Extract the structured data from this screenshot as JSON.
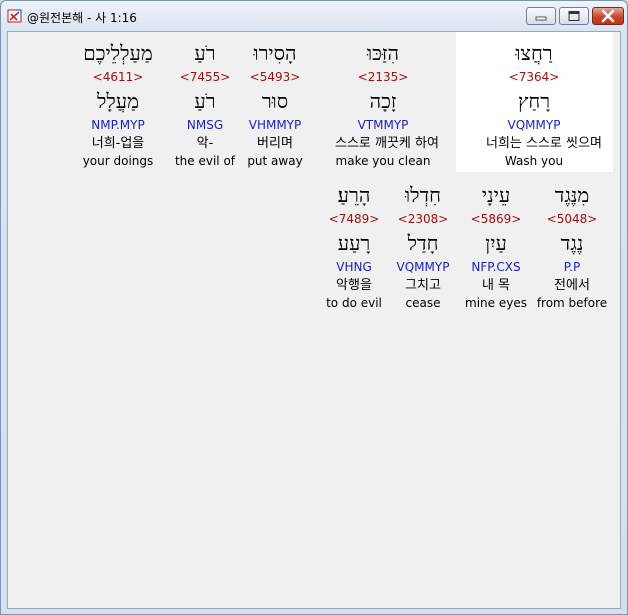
{
  "window": {
    "title": "@원전본해 - 사 1:16"
  },
  "colors": {
    "strong": "#a01010",
    "morph": "#1a22c0",
    "highlight": "#ffffff"
  },
  "rows": [
    {
      "words": [
        {
          "hebrew": "רַחֲצוּ",
          "strong": "<7364>",
          "lemma": "רָחַץ",
          "morph": "VQMMYP",
          "korean": "너희는 스스로 씻으며",
          "english": "Wash you",
          "highlighted": true
        },
        {
          "hebrew": "הִזַּכּוּ",
          "strong": "<2135>",
          "lemma": "זָכָה",
          "morph": "VTMMYP",
          "korean": "스스로 깨끗케 하여",
          "english": "make you clean"
        },
        {
          "hebrew": "הָסִירוּ",
          "strong": "<5493>",
          "lemma": "סוּר",
          "morph": "VHMMYP",
          "korean": "버리며",
          "english": "put away"
        },
        {
          "hebrew": "רֹעַ",
          "strong": "<7455>",
          "lemma": "רֹעַ",
          "morph": "NMSG",
          "korean": "악-",
          "english": "the evil of"
        },
        {
          "hebrew": "מַעַלְלֵיכֶם",
          "strong": "<4611>",
          "lemma": "מַעֲלָל",
          "morph": "NMP.MYP",
          "korean": "너희-업을",
          "english": "your doings"
        }
      ]
    },
    {
      "words": [
        {
          "hebrew": "מִנֶּגֶד",
          "strong": "<5048>",
          "lemma": "נֶגֶד",
          "morph": "P.P",
          "korean": "전에서",
          "english": "from before"
        },
        {
          "hebrew": "עֵינָי",
          "strong": "<5869>",
          "lemma": "עַיִן",
          "morph": "NFP.CXS",
          "korean": "내 목",
          "english": "mine eyes"
        },
        {
          "hebrew": "חִדְלוּ",
          "strong": "<2308>",
          "lemma": "חָדַל",
          "morph": "VQMMYP",
          "korean": "그치고",
          "english": "cease"
        },
        {
          "hebrew": "הָרֵעַ׃",
          "strong": "<7489>",
          "lemma": "רָעַע",
          "morph": "VHNG",
          "korean": "악행을",
          "english": "to do evil"
        }
      ]
    }
  ]
}
